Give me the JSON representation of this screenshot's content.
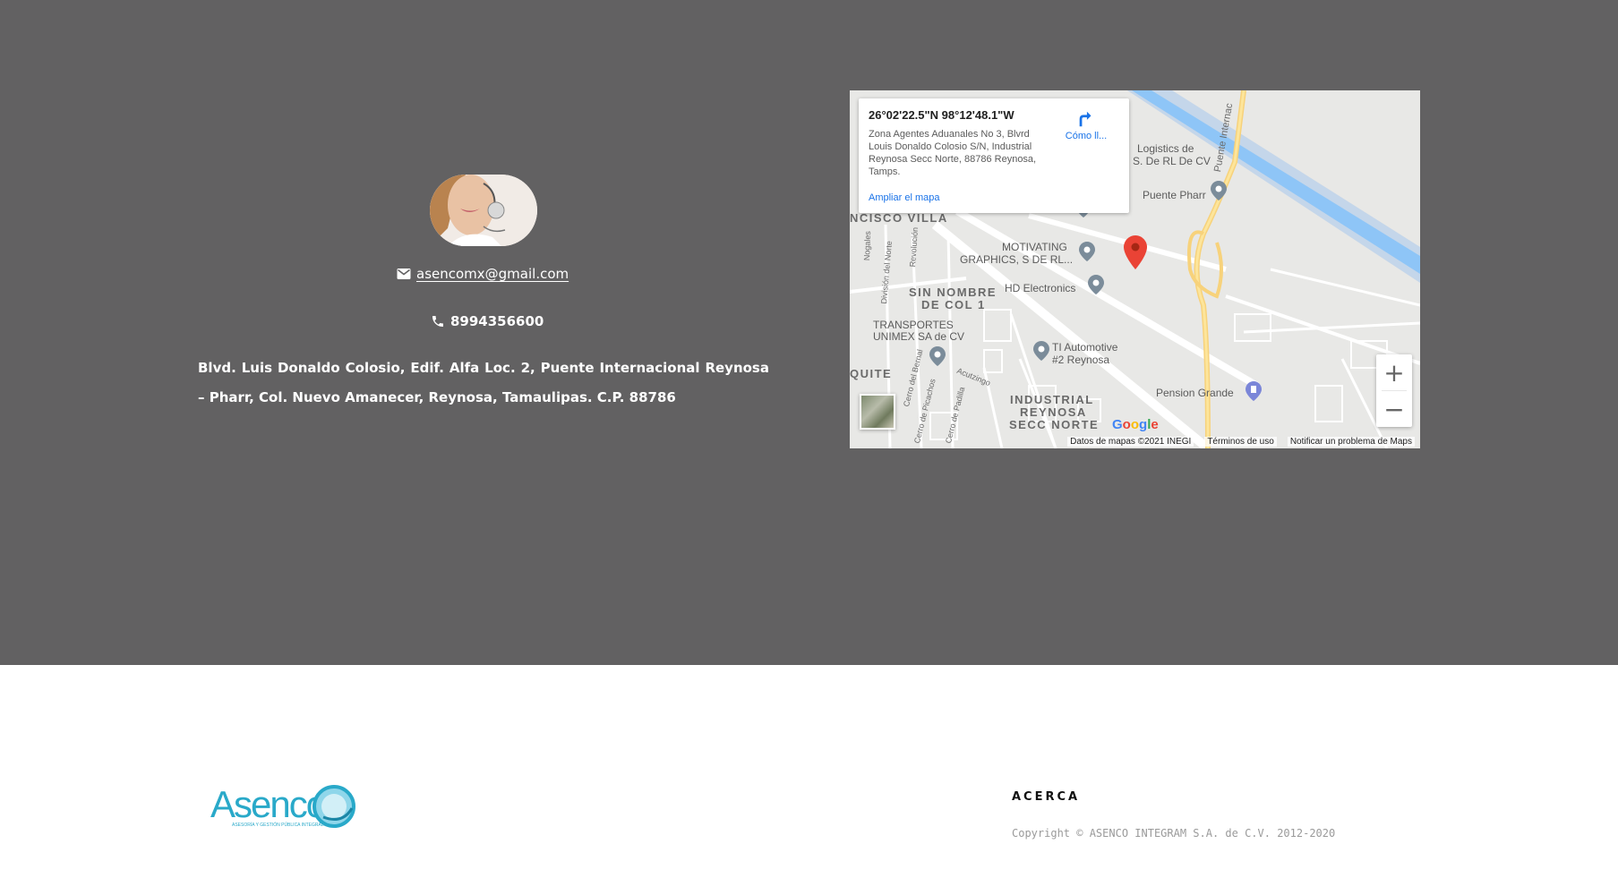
{
  "contact": {
    "email": "asencomx@gmail.com",
    "email_icon": "mail-icon",
    "phone": "8994356600",
    "phone_icon": "phone-icon",
    "address": "Blvd. Luis Donaldo Colosio, Edif. Alfa Loc. 2, Puente Internacional Reynosa – Pharr, Col. Nuevo Amanecer, Reynosa, Tamaulipas. C.P. 88786"
  },
  "map": {
    "info": {
      "coords": "26°02'22.5\"N 98°12'48.1\"W",
      "address": "Zona Agentes Aduanales No 3, Blvrd Louis Donaldo Colosio S/N, Industrial Reynosa Secc Norte, 88786 Reynosa, Tamps.",
      "enlarge": "Ampliar el mapa",
      "directions": "Cómo ll..."
    },
    "labels": {
      "logistics": "Logistics de",
      "logistics2": "S. De RL De CV",
      "puente_pharr": "Puente Pharr",
      "puente_internac": "Puente Internac",
      "francisco_villa": "NCISCO VILLA",
      "motivating": "MOTIVATING",
      "graphics": "GRAPHICS, S DE RL...",
      "hd_electronics": "HD Electronics",
      "sin_nombre": "SIN NOMBRE",
      "de_col": "DE COL 1",
      "transportes": "TRANSPORTES",
      "unimex": "UNIMEX SA de CV",
      "ti_automotive": "TI Automotive",
      "reynosa2": "#2 Reynosa",
      "quite": "QUITE",
      "industrial": "INDUSTRIAL",
      "reynosa": "REYNOSA",
      "secc_norte": "SECC NORTE",
      "pension": "Pension Grande",
      "nogales": "Nogales",
      "division": "División del Norte",
      "revolucion": "Revolución",
      "cerro_bernal": "Cerro del Bernal",
      "cerro_picachos": "Cerro de Picachos",
      "cerro_padilla": "Cerro de Padilla",
      "acutzingo": "Acutzingo"
    },
    "google": "Google",
    "attribution": {
      "data": "Datos de mapas ©2021 INEGI",
      "terms": "Términos de uso",
      "report": "Notificar un problema de Maps"
    },
    "zoom_in": "+",
    "zoom_out": "−"
  },
  "footer": {
    "logo_text": "Asenco",
    "logo_tagline": "ASESORÍA Y GESTIÓN PÚBLICA INTEGRAL",
    "heading": "ACERCA",
    "copyright": "Copyright © ASENCO INTEGRAM S.A. de C.V. 2012-2020"
  },
  "colors": {
    "band": "#626162",
    "logo": "#29a9c9",
    "link": "#1a73e8",
    "pin_red": "#ea4335"
  }
}
